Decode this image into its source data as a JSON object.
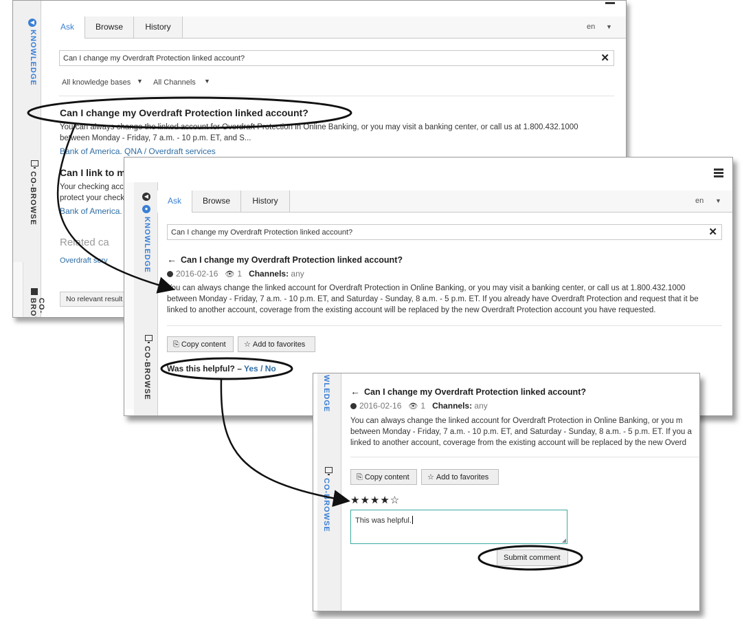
{
  "side": {
    "knowledge_label": "KNOWLEDGE",
    "cobrowse_label": "CO-BROWSE",
    "knowledge_short": "WLEDGE"
  },
  "tabs": {
    "ask": "Ask",
    "browse": "Browse",
    "history": "History",
    "language": "en"
  },
  "search": {
    "query": "Can I change my Overdraft Protection linked account?"
  },
  "filters": {
    "knowledge_bases": "All knowledge bases",
    "channels": "All Channels"
  },
  "results": [
    {
      "title": "Can I change my Overdraft Protection linked account?",
      "snippet_line1": "You can always change the linked account for Overdraft Protection in Online Banking, or you may visit a banking center, or call us at 1.800.432.1000",
      "snippet_line2": "between Monday - Friday, 7 a.m. - 10 p.m. ET, and S...",
      "source": "Bank of America. QNA / Overdraft services"
    },
    {
      "title": "Can I link to mo",
      "snippet_line1": "Your checking acco",
      "snippet_line2": "protect your check",
      "source": "Bank of America."
    }
  ],
  "related": {
    "heading": "Related ca",
    "link": "Overdraft serv",
    "no_results": "No relevant result"
  },
  "article": {
    "title": "Can I change my Overdraft Protection linked account?",
    "date": "2016-02-16",
    "views": "1",
    "channels_label": "Channels:",
    "channels_value": "any",
    "body_line1": "You can always change the linked account for Overdraft Protection in Online Banking, or you may visit a banking center, or call us at 1.800.432.1000",
    "body_line2": "between Monday - Friday, 7 a.m. - 10 p.m. ET, and Saturday - Sunday, 8 a.m. - 5 p.m. ET. If you already have Overdraft Protection and request that it be",
    "body_line3": "linked to another account, coverage from the existing account will be replaced by the new Overdraft Protection account you have requested.",
    "body_line1_clipped": "You can always change the linked account for Overdraft Protection in Online Banking, or you m",
    "body_line2_clipped": "between Monday - Friday, 7 a.m. - 10 p.m. ET, and Saturday - Sunday, 8 a.m. - 5 p.m. ET. If you a",
    "body_line3_clipped": "linked to another account, coverage from the existing account will be replaced by the new Overd"
  },
  "actions": {
    "copy": "Copy content",
    "favorites": "Add to favorites"
  },
  "feedback": {
    "question": "Was this helpful? –",
    "yes": "Yes",
    "separator": "/",
    "no": "No"
  },
  "rating": {
    "stars": "★★★★☆",
    "value": 4,
    "max": 5
  },
  "comment": {
    "text": "This was helpful.",
    "submit": "Submit comment"
  },
  "colors": {
    "accent": "#3a7fd5",
    "link": "#2e6da4",
    "comment_border": "#3aa9a0"
  }
}
